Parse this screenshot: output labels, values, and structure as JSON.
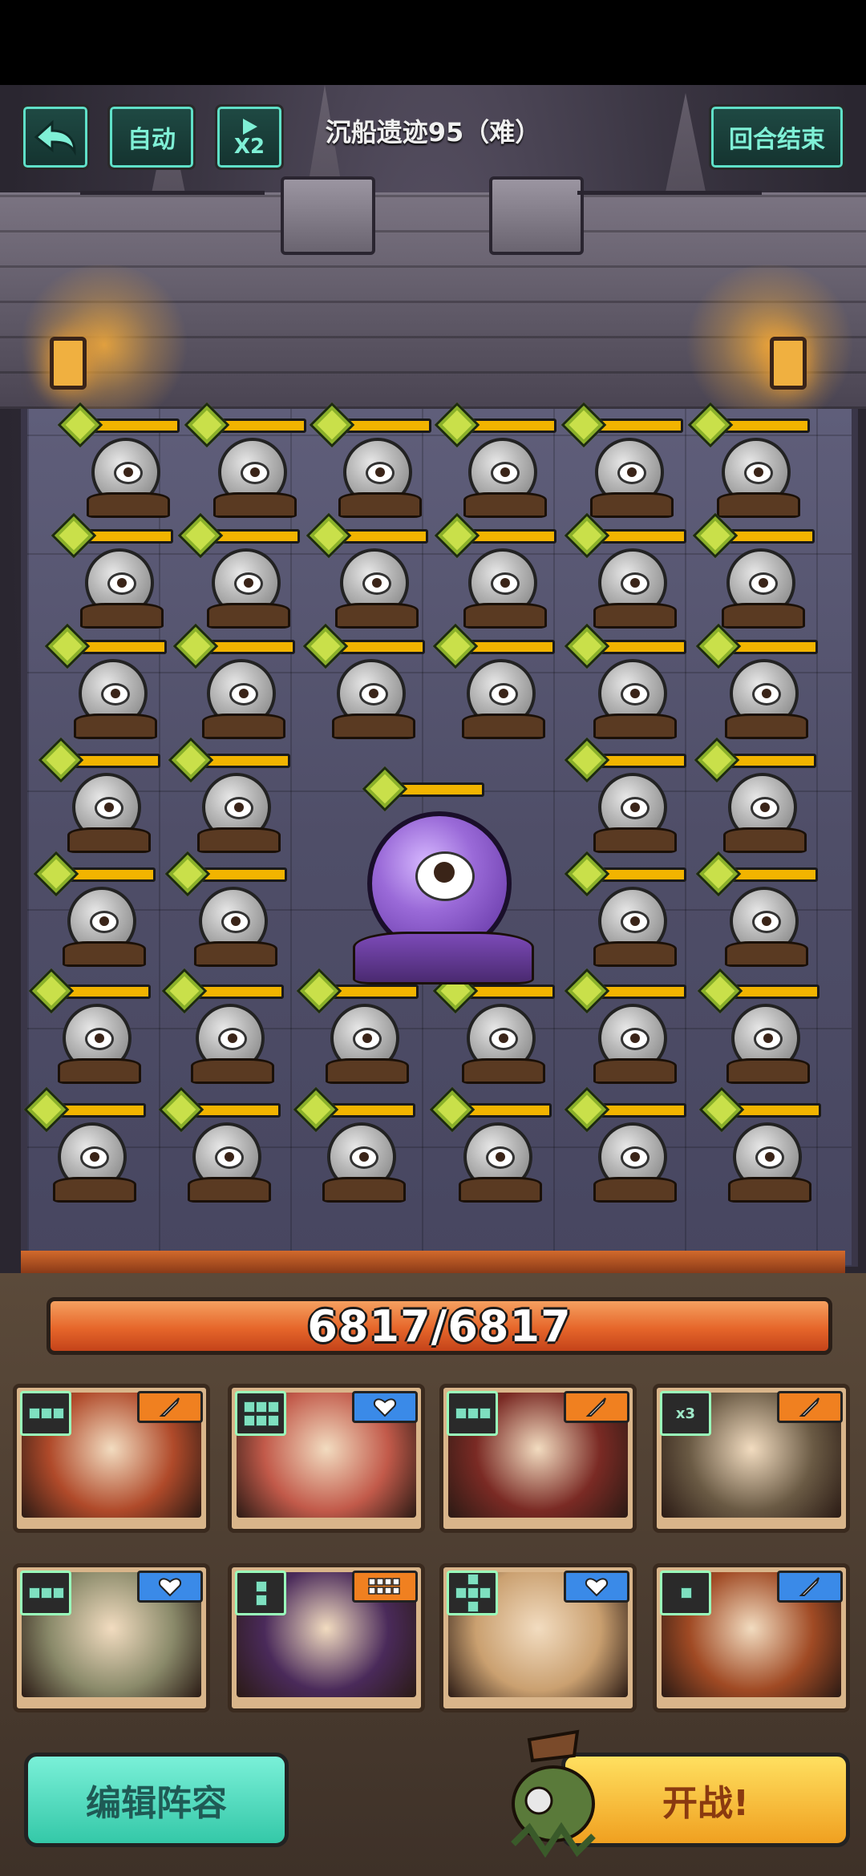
{
  "header": {
    "back_icon": "back-arrow-icon",
    "auto_label": "自动",
    "speed_icon": "play-icon",
    "speed_label": "X2",
    "level_title": "沉船遗迹95（难）",
    "end_turn_label": "回合结束"
  },
  "team": {
    "hp_text": "6817/6817",
    "hp_current": 6817,
    "hp_max": 6817
  },
  "heroes": [
    {
      "role_icon": "sword-icon",
      "role_color": "#f08020",
      "shape": "1x3",
      "portrait_color": "#b04a2a"
    },
    {
      "role_icon": "heart-icon",
      "role_color": "#3a8ae8",
      "shape": "2x3",
      "portrait_color": "#c25a4a"
    },
    {
      "role_icon": "sword-icon",
      "role_color": "#f08020",
      "shape": "1x3",
      "portrait_color": "#7a2a24"
    },
    {
      "role_icon": "sword-icon",
      "role_color": "#f08020",
      "shape": "x3",
      "shape_label": "x3",
      "portrait_color": "#6a5a44"
    },
    {
      "role_icon": "heart-icon",
      "role_color": "#3a8ae8",
      "shape": "1x3",
      "portrait_color": "#8a8a6a"
    },
    {
      "role_icon": "grid-icon",
      "role_color": "#f08020",
      "shape": "2x1",
      "portrait_color": "#4a2a5a"
    },
    {
      "role_icon": "heart-icon",
      "role_color": "#3a8ae8",
      "shape": "cross",
      "portrait_color": "#caa070"
    },
    {
      "role_icon": "sword-icon",
      "role_color": "#3a8ae8",
      "shape": "1x1",
      "portrait_color": "#a04a24"
    }
  ],
  "footer": {
    "edit_label": "编辑阵容",
    "fight_label": "开战!"
  }
}
